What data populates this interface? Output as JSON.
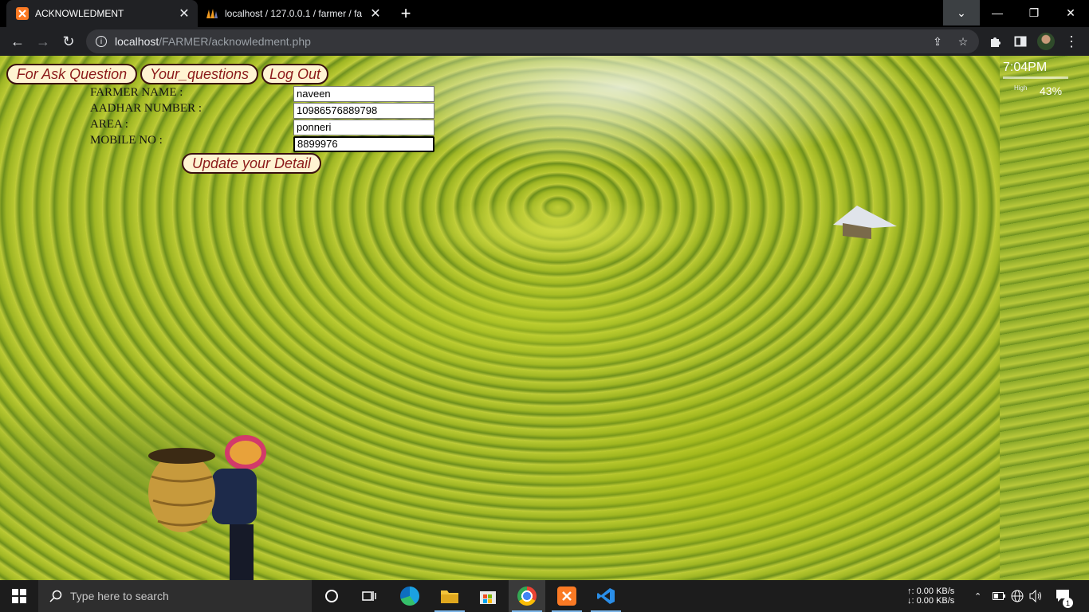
{
  "browser": {
    "tabs": [
      {
        "title": "ACKNOWLEDMENT",
        "active": true
      },
      {
        "title": "localhost / 127.0.0.1 / farmer / fa",
        "active": false
      }
    ],
    "url_host": "localhost",
    "url_path": "/FARMER/acknowledment.php"
  },
  "page": {
    "nav": {
      "ask_question": "For Ask Question",
      "your_questions": "Your_questions",
      "log_out": "Log Out"
    },
    "form": {
      "farmer_name_label": "FARMER NAME :",
      "aadhar_label": "AADHAR NUMBER :",
      "area_label": "AREA :",
      "mobile_label": "MOBILE NO :",
      "farmer_name_value": "naveen",
      "aadhar_value": "10986576889798",
      "area_value": "ponneri",
      "mobile_value": "8899976",
      "update_button": "Update your Detail"
    }
  },
  "widget": {
    "time": "7:04PM",
    "high_label": "High",
    "percent": "43%"
  },
  "taskbar": {
    "search_placeholder": "Type here to search",
    "net_up": "↑: 0.00 KB/s",
    "net_down": "↓: 0.00 KB/s",
    "notification_count": "1"
  },
  "colors": {
    "nav_button_bg": "#fff4d2",
    "nav_button_text": "#8b1a1a",
    "chrome_dark": "#202124"
  }
}
